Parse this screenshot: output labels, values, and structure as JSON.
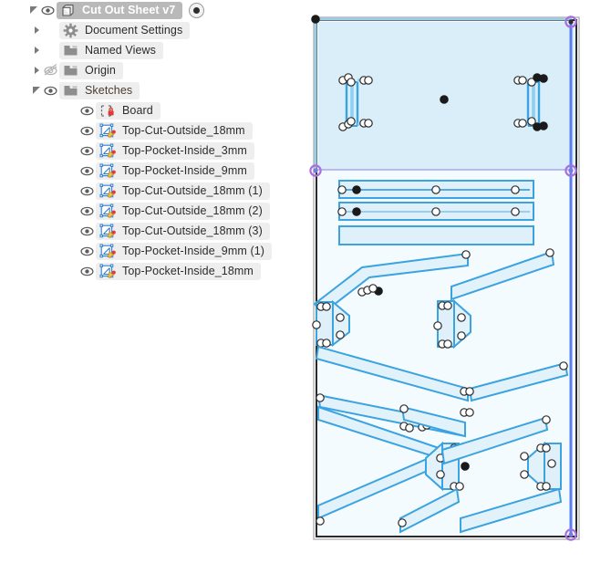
{
  "browser": {
    "title_row": {
      "label": "Cut Out Sheet v7",
      "icon": "document-cube-icon",
      "eye_icon": "eye-visible-icon",
      "radio_icon": "active-document-radio-icon",
      "selected": true,
      "expanded": true
    },
    "items": [
      {
        "label": "Document Settings",
        "icon": "gear-icon",
        "eye": "none",
        "twisty": "closed",
        "indent": 1
      },
      {
        "label": "Named Views",
        "icon": "folder-icon",
        "eye": "none",
        "twisty": "closed",
        "indent": 1
      },
      {
        "label": "Origin",
        "icon": "folder-icon",
        "eye": "eye-hidden-icon",
        "twisty": "closed",
        "indent": 1
      },
      {
        "label": "Sketches",
        "icon": "folder-icon",
        "eye": "eye-visible-icon",
        "twisty": "open",
        "indent": 1
      },
      {
        "label": "Board",
        "icon": "sketch-locked-icon",
        "eye": "eye-visible-icon",
        "twisty": "none",
        "indent": 2
      },
      {
        "label": "Top-Cut-Outside_18mm",
        "icon": "sketch-icon",
        "eye": "eye-visible-icon",
        "twisty": "none",
        "indent": 2
      },
      {
        "label": "Top-Pocket-Inside_3mm",
        "icon": "sketch-icon",
        "eye": "eye-visible-icon",
        "twisty": "none",
        "indent": 2
      },
      {
        "label": "Top-Pocket-Inside_9mm",
        "icon": "sketch-icon",
        "eye": "eye-visible-icon",
        "twisty": "none",
        "indent": 2
      },
      {
        "label": "Top-Cut-Outside_18mm (1)",
        "icon": "sketch-icon",
        "eye": "eye-visible-icon",
        "twisty": "none",
        "indent": 2
      },
      {
        "label": "Top-Cut-Outside_18mm (2)",
        "icon": "sketch-icon",
        "eye": "eye-visible-icon",
        "twisty": "none",
        "indent": 2
      },
      {
        "label": "Top-Cut-Outside_18mm (3)",
        "icon": "sketch-icon",
        "eye": "eye-visible-icon",
        "twisty": "none",
        "indent": 2
      },
      {
        "label": "Top-Pocket-Inside_9mm (1)",
        "icon": "sketch-icon",
        "eye": "eye-visible-icon",
        "twisty": "none",
        "indent": 2
      },
      {
        "label": "Top-Pocket-Inside_18mm",
        "icon": "sketch-icon",
        "eye": "eye-visible-icon",
        "twisty": "none",
        "indent": 2
      }
    ]
  },
  "colors": {
    "selected_row_bg": "#b9b9b9",
    "row_bg": "#efeeee",
    "sketch_line": "#3ba3e0",
    "sketch_fill": "#d7edf9",
    "board_fill": "#f2fafd",
    "handle_purple": "#a96fe0",
    "handle_blue": "#5a7ef0",
    "point_white": "#ffffff",
    "point_black": "#1a1a1a",
    "board_outline": "#2a2a2a",
    "sketch_folder_text": "#4a3b30"
  },
  "canvas": {
    "name": "sketch-canvas",
    "board_outline_label": "board-rectangle",
    "selected_profile_label": "selected-sketch-profile"
  }
}
